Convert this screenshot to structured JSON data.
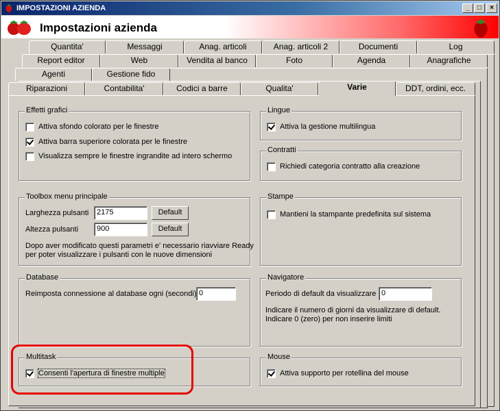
{
  "window": {
    "title": "IMPOSTAZIONI AZIENDA",
    "controls": {
      "minimize": "_",
      "maximize": "□",
      "close": "×"
    }
  },
  "header": {
    "title": "Impostazioni azienda"
  },
  "tabs": {
    "row1": [
      "Quantita'",
      "Messaggi",
      "Anag. articoli",
      "Anag. articoli 2",
      "Documenti",
      "Log"
    ],
    "row2": [
      "Report editor",
      "Web",
      "Vendita al banco",
      "Foto",
      "Agenda",
      "Anagrafiche"
    ],
    "row3": [
      "Agenti",
      "Gestione fido"
    ],
    "row4": [
      "Riparazioni",
      "Contabilita'",
      "Codici a barre",
      "Qualita'",
      "Varie",
      "DDT, ordini, ecc."
    ]
  },
  "effetti_grafici": {
    "title": "Effetti grafici",
    "options": [
      {
        "label": "Attiva sfondo colorato per le finestre",
        "checked": false
      },
      {
        "label": "Attiva barra superiore colorata per le finestre",
        "checked": true
      },
      {
        "label": "Visualizza sempre le finestre ingrandite ad intero schermo",
        "checked": false
      }
    ]
  },
  "lingue": {
    "title": "Lingue",
    "option": {
      "label": "Attiva la gestione multilingua",
      "checked": true
    }
  },
  "contratti": {
    "title": "Contratti",
    "option": {
      "label": "Richiedi categoria contratto alla creazione",
      "checked": false
    }
  },
  "toolbox": {
    "title": "Toolbox menu principale",
    "larghezza_label": "Larghezza pulsanti",
    "larghezza_value": "2175",
    "altezza_label": "Altezza pulsanti",
    "altezza_value": "900",
    "default_label": "Default",
    "note_line1": "Dopo aver modificato questi parametri e' necessario riavviare Ready",
    "note_line2": "per poter visualizzare i pulsanti con le nuove dimensioni"
  },
  "stampe": {
    "title": "Stampe",
    "option": {
      "label": "Mantieni la stampante predefinita sul sistema",
      "checked": false
    }
  },
  "database": {
    "title": "Database",
    "label": "Reimposta connessione al database ogni (secondi)",
    "value": "0"
  },
  "navigatore": {
    "title": "Navigatore",
    "label": "Periodo di default da visualizzare",
    "value": "0",
    "note_line1": "Indicare il numero di giorni da visualizzare di default.",
    "note_line2": "Indicare 0 (zero) per non inserire limiti"
  },
  "multitask": {
    "title": "Multitask",
    "option": {
      "label": "Consenti l'apertura di finestre multiple",
      "checked": true
    }
  },
  "mouse": {
    "title": "Mouse",
    "option": {
      "label": "Attiva supporto per rotellina del mouse",
      "checked": true
    }
  },
  "colors": {
    "highlight": "#e60000",
    "title_bar": "#0a246a",
    "header_accent": "#ff0000"
  }
}
